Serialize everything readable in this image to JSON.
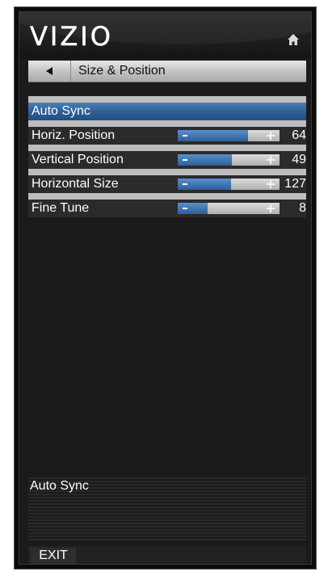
{
  "header": {
    "logo_text": "VIZIO",
    "home_icon": "home-icon"
  },
  "menu": {
    "title": "Size & Position",
    "back_icon": "left-triangle-icon",
    "items": [
      {
        "label": "Auto Sync",
        "selected": true
      },
      {
        "label": "Horiz. Position",
        "value": "64",
        "level": 0.69
      },
      {
        "label": "Vertical Position",
        "value": "49",
        "level": 0.53
      },
      {
        "label": "Horizontal Size",
        "value": "127",
        "level": 0.52
      },
      {
        "label": "Fine Tune",
        "value": "8",
        "level": 0.29
      }
    ]
  },
  "description": {
    "text": "Auto Sync"
  },
  "footer": {
    "exit_label": "EXIT"
  },
  "colors": {
    "selected_row": "#2b5d94",
    "slider_fill": "#2d5f9a",
    "panel_bg": "#1c1a1b"
  }
}
